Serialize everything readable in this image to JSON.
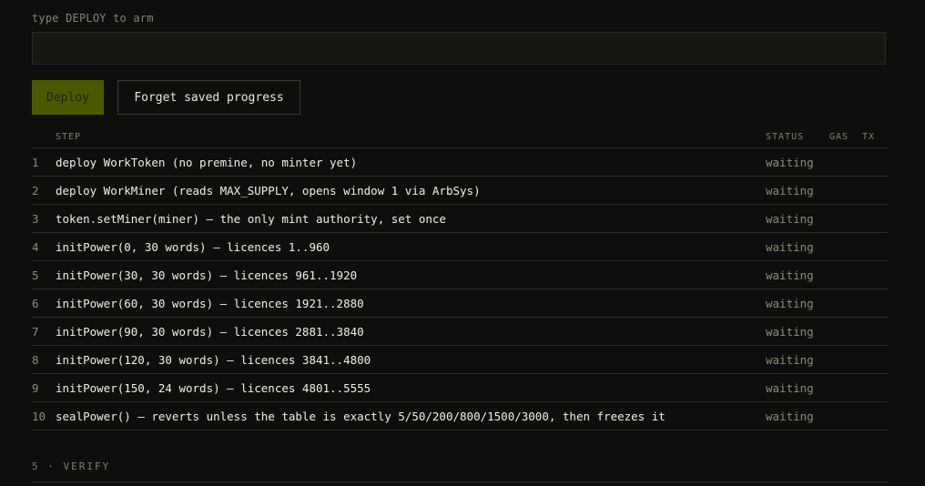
{
  "arm": {
    "label": "type DEPLOY to arm",
    "value": "",
    "placeholder": ""
  },
  "buttons": {
    "deploy": "Deploy",
    "forget": "Forget saved progress"
  },
  "table": {
    "headers": {
      "step": "STEP",
      "status": "STATUS",
      "gas": "GAS",
      "tx": "TX"
    },
    "rows": [
      {
        "num": "1",
        "step": "deploy WorkToken (no premine, no minter yet)",
        "status": "waiting",
        "gas": "",
        "tx": ""
      },
      {
        "num": "2",
        "step": "deploy WorkMiner (reads MAX_SUPPLY, opens window 1 via ArbSys)",
        "status": "waiting",
        "gas": "",
        "tx": ""
      },
      {
        "num": "3",
        "step": "token.setMiner(miner) — the only mint authority, set once",
        "status": "waiting",
        "gas": "",
        "tx": ""
      },
      {
        "num": "4",
        "step": "initPower(0, 30 words) — licences 1..960",
        "status": "waiting",
        "gas": "",
        "tx": ""
      },
      {
        "num": "5",
        "step": "initPower(30, 30 words) — licences 961..1920",
        "status": "waiting",
        "gas": "",
        "tx": ""
      },
      {
        "num": "6",
        "step": "initPower(60, 30 words) — licences 1921..2880",
        "status": "waiting",
        "gas": "",
        "tx": ""
      },
      {
        "num": "7",
        "step": "initPower(90, 30 words) — licences 2881..3840",
        "status": "waiting",
        "gas": "",
        "tx": ""
      },
      {
        "num": "8",
        "step": "initPower(120, 30 words) — licences 3841..4800",
        "status": "waiting",
        "gas": "",
        "tx": ""
      },
      {
        "num": "9",
        "step": "initPower(150, 24 words) — licences 4801..5555",
        "status": "waiting",
        "gas": "",
        "tx": ""
      },
      {
        "num": "10",
        "step": "sealPower() — reverts unless the table is exactly 5/50/200/800/1500/3000, then freezes it",
        "status": "waiting",
        "gas": "",
        "tx": ""
      }
    ]
  },
  "verify": {
    "heading": "5 · VERIFY"
  }
}
